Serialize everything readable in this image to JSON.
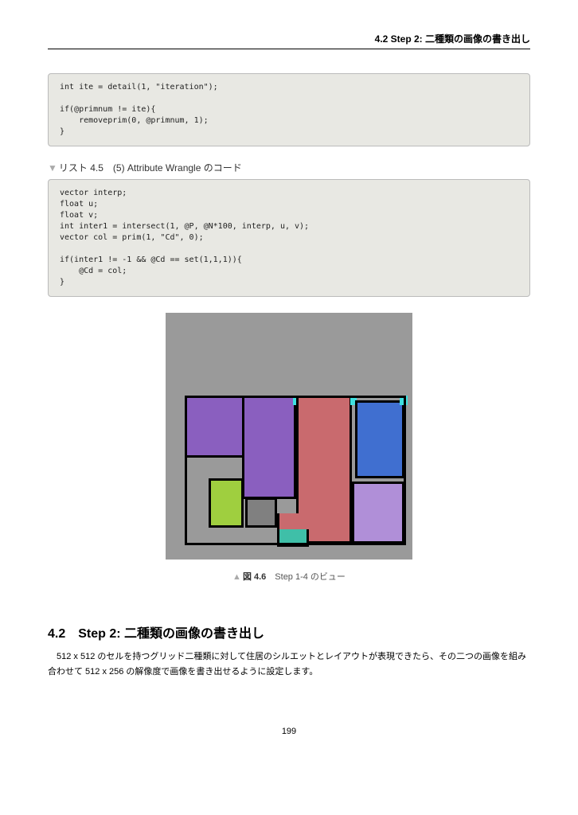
{
  "header": "4.2 Step 2: 二種類の画像の書き出し",
  "code1": "int ite = detail(1, \"iteration\");\n\nif(@primnum != ite){\n    removeprim(0, @primnum, 1);\n}",
  "list45_label": "リスト 4.5　(5) Attribute Wrangle のコード",
  "code2": "vector interp;\nfloat u;\nfloat v;\nint inter1 = intersect(1, @P, @N*100, interp, u, v);\nvector col = prim(1, \"Cd\", 0);\n\nif(inter1 != -1 && @Cd == set(1,1,1)){\n    @Cd = col;\n}",
  "fig46_caption_label": "図 4.6",
  "fig46_caption_text": "Step 1-4 のビュー",
  "section_heading": "4.2　Step 2: 二種類の画像の書き出し",
  "paragraph": "512 x 512 のセルを持つグリッド二種類に対して住居のシルエットとレイアウトが表現できたら、その二つの画像を組み合わせて 512 x 256 の解像度で画像を書き出せるように設定します。",
  "page_number": "199"
}
